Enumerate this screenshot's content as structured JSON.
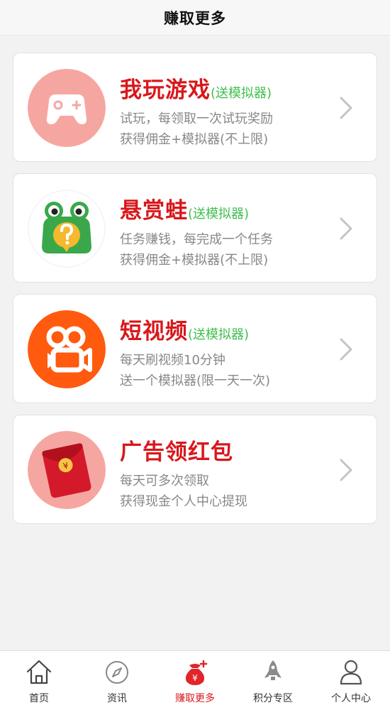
{
  "header": {
    "title": "赚取更多"
  },
  "cards": [
    {
      "title": "我玩游戏",
      "tag": "(送模拟器)",
      "desc_line1": "试玩，每领取一次试玩奖励",
      "desc_line2": "获得佣金+模拟器(不上限)",
      "icon": "gamepad-icon"
    },
    {
      "title": "悬赏蛙",
      "tag": "(送模拟器)",
      "desc_line1": "任务赚钱，每完成一个任务",
      "desc_line2": "获得佣金+模拟器(不上限)",
      "icon": "frog-icon"
    },
    {
      "title": "短视频",
      "tag": "(送模拟器)",
      "desc_line1": "每天刷视频10分钟",
      "desc_line2": "送一个模拟器(限一天一次)",
      "icon": "video-camera-icon"
    },
    {
      "title": "广告领红包",
      "tag": "",
      "desc_line1": "每天可多次领取",
      "desc_line2": "获得现金个人中心提现",
      "icon": "red-envelope-icon"
    }
  ],
  "tabbar": {
    "items": [
      {
        "label": "首页",
        "icon": "home-icon",
        "active": false
      },
      {
        "label": "资讯",
        "icon": "compass-icon",
        "active": false
      },
      {
        "label": "赚取更多",
        "icon": "money-bag-icon",
        "active": true
      },
      {
        "label": "积分专区",
        "icon": "rocket-icon",
        "active": false
      },
      {
        "label": "个人中心",
        "icon": "user-icon",
        "active": false
      }
    ]
  },
  "colors": {
    "title_red": "#d8181c",
    "tag_green": "#3fbf4e",
    "desc_gray": "#888888",
    "background": "#f2f2f2"
  }
}
